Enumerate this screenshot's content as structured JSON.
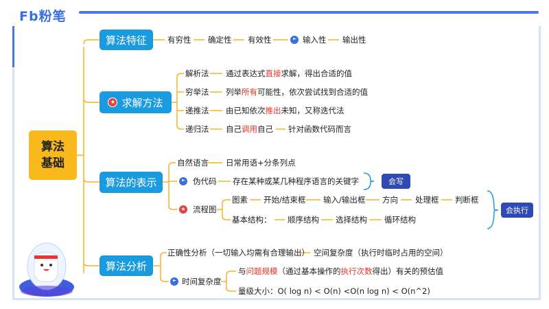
{
  "brand": {
    "logo": "Fb粉笔"
  },
  "root": {
    "line1": "算法",
    "line2": "基础"
  },
  "features": {
    "label": "算法特征",
    "items": [
      "有穷性",
      "确定性",
      "有效性",
      "输入性",
      "输出性"
    ]
  },
  "methods": {
    "label": "求解方法",
    "rows": [
      {
        "name": "解析法",
        "pre": "通过表达式",
        "hl": "直接",
        "post": "求解，得出合适的值"
      },
      {
        "name": "穷举法",
        "pre": "列举",
        "hl": "所有",
        "post": "可能性，依次尝试找到合适的值"
      },
      {
        "name": "递推法",
        "pre": "由已知依次",
        "hl": "推出",
        "post": "未知，又称迭代法"
      },
      {
        "name": "递归法",
        "pre": "自己",
        "hl": "调用",
        "post": "自己",
        "extra": "针对函数代码而言"
      }
    ]
  },
  "representation": {
    "label": "算法的表示",
    "natural": {
      "name": "自然语言",
      "desc": "日常用语+分条列点"
    },
    "pseudo": {
      "name": "伪代码",
      "desc": "存在某种或某几种程序语言的关键字",
      "tag": "会写"
    },
    "flow": {
      "name": "流程图",
      "elements_label": "图素",
      "elements": [
        "开始/结束框",
        "输入/输出框",
        "方向",
        "处理框",
        "判断框"
      ],
      "structure_label": "基本结构：",
      "structures": [
        "顺序结构",
        "选择结构",
        "循环结构"
      ],
      "tag": "会执行"
    }
  },
  "analysis": {
    "label": "算法分析",
    "correctness": "正确性分析（一切输入均需有合理输出）",
    "space": "空间复杂度（执行时临时占用的空间）",
    "time": {
      "name": "时间复杂度",
      "p1": "与",
      "h1": "问题规模",
      "p2": "（通过基本操作的",
      "h2": "执行次数",
      "p3": "得出）有关的预估值",
      "order": "量级大小：O( log n) < O(n) <O(n log n) < O(n^2)"
    }
  },
  "colors": {
    "accent": "#1a9be0",
    "root": "#f9b81b",
    "line": "#f5b324",
    "tag": "#2f49b5",
    "highlight": "#e8322b"
  }
}
